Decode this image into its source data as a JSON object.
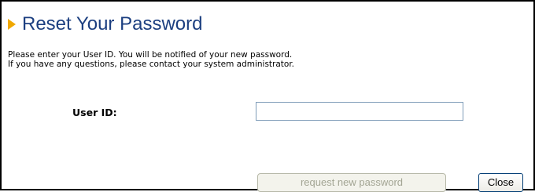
{
  "dialog": {
    "title": "Reset Your Password",
    "description_lines": [
      "Please enter your User ID. You will be notified of your new password.",
      "If you have any questions, please contact your system administrator."
    ],
    "form": {
      "userid_label": "User ID:",
      "userid_value": "",
      "userid_placeholder": ""
    },
    "buttons": {
      "request_label": "request new password",
      "request_enabled": false,
      "close_label": "Close"
    }
  },
  "colors": {
    "title_text": "#1c3f80",
    "title_arrow": "#f0a800",
    "border": "#000000",
    "input_border": "#7f9db9",
    "disabled_text": "#a3a594",
    "close_border": "#003c74"
  },
  "icons": {
    "title_marker": "triangle-right-icon"
  }
}
